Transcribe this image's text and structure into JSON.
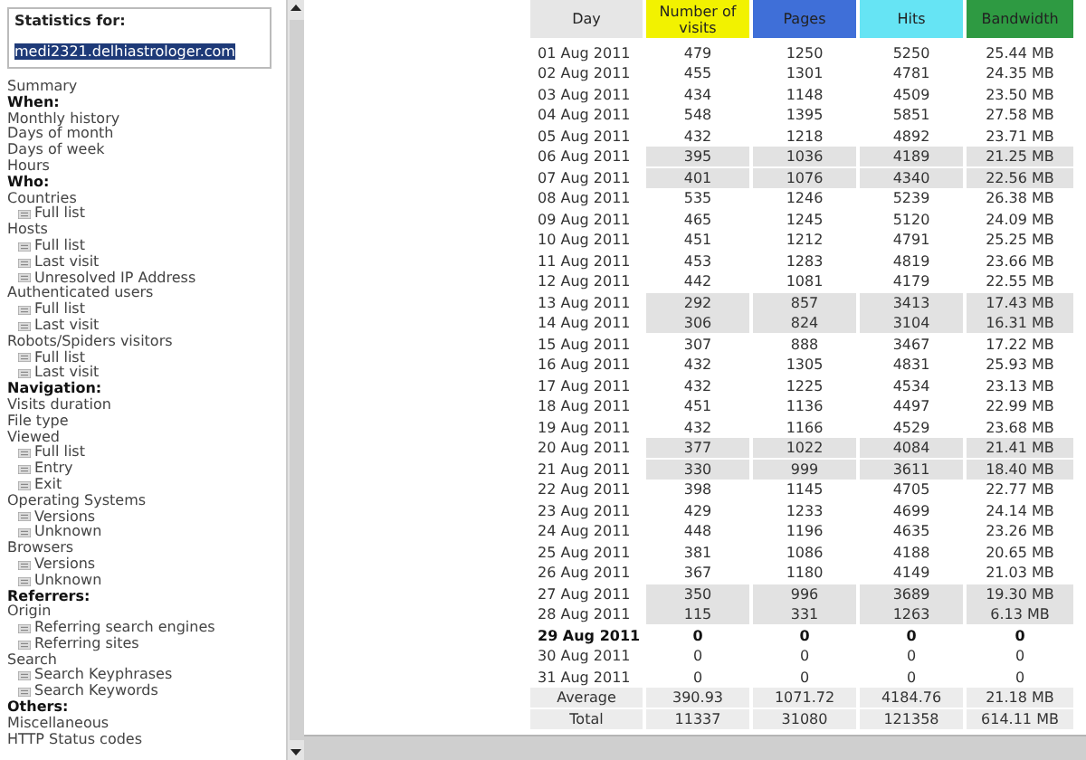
{
  "stats_box": {
    "label": "Statistics for:",
    "host": "medi2321.delhiastrologer.com"
  },
  "menu": [
    {
      "kind": "link",
      "label": "Summary"
    },
    {
      "kind": "heading",
      "label": "When:"
    },
    {
      "kind": "link",
      "label": "Monthly history"
    },
    {
      "kind": "link",
      "label": "Days of month"
    },
    {
      "kind": "link",
      "label": "Days of week"
    },
    {
      "kind": "link",
      "label": "Hours"
    },
    {
      "kind": "heading",
      "label": "Who:"
    },
    {
      "kind": "link",
      "label": "Countries",
      "children": [
        {
          "label": "Full list"
        }
      ]
    },
    {
      "kind": "link",
      "label": "Hosts",
      "children": [
        {
          "label": "Full list"
        },
        {
          "label": "Last visit"
        },
        {
          "label": "Unresolved IP Address"
        }
      ]
    },
    {
      "kind": "link",
      "label": "Authenticated users",
      "children": [
        {
          "label": "Full list"
        },
        {
          "label": "Last visit"
        }
      ]
    },
    {
      "kind": "link",
      "label": "Robots/Spiders visitors",
      "children": [
        {
          "label": "Full list"
        },
        {
          "label": "Last visit"
        }
      ]
    },
    {
      "kind": "heading",
      "label": "Navigation:"
    },
    {
      "kind": "link",
      "label": "Visits duration"
    },
    {
      "kind": "link",
      "label": "File type"
    },
    {
      "kind": "link",
      "label": "Viewed",
      "children": [
        {
          "label": "Full list"
        },
        {
          "label": "Entry"
        },
        {
          "label": "Exit"
        }
      ]
    },
    {
      "kind": "link",
      "label": "Operating Systems",
      "children": [
        {
          "label": "Versions"
        },
        {
          "label": "Unknown"
        }
      ]
    },
    {
      "kind": "link",
      "label": "Browsers",
      "children": [
        {
          "label": "Versions"
        },
        {
          "label": "Unknown"
        }
      ]
    },
    {
      "kind": "heading",
      "label": "Referrers:"
    },
    {
      "kind": "link",
      "label": "Origin",
      "children": [
        {
          "label": "Referring search engines"
        },
        {
          "label": "Referring sites"
        }
      ]
    },
    {
      "kind": "link",
      "label": "Search",
      "children": [
        {
          "label": "Search Keyphrases"
        },
        {
          "label": "Search Keywords"
        }
      ]
    },
    {
      "kind": "heading",
      "label": "Others:"
    },
    {
      "kind": "link",
      "label": "Miscellaneous"
    },
    {
      "kind": "link",
      "label": "HTTP Status codes"
    }
  ],
  "table": {
    "columns": [
      {
        "label": "Day",
        "color": "#e6e6e6"
      },
      {
        "label": "Number of visits",
        "color": "#f2f200"
      },
      {
        "label": "Pages",
        "color": "#3f6fd8"
      },
      {
        "label": "Hits",
        "color": "#66e4f4"
      },
      {
        "label": "Bandwidth",
        "color": "#2e9a42"
      }
    ],
    "rows": [
      {
        "day": "01 Aug 2011",
        "visits": "479",
        "pages": "1250",
        "hits": "5250",
        "bandwidth": "25.44 MB",
        "weekend": false,
        "current": false
      },
      {
        "day": "02 Aug 2011",
        "visits": "455",
        "pages": "1301",
        "hits": "4781",
        "bandwidth": "24.35 MB",
        "weekend": false,
        "current": false
      },
      {
        "day": "03 Aug 2011",
        "visits": "434",
        "pages": "1148",
        "hits": "4509",
        "bandwidth": "23.50 MB",
        "weekend": false,
        "current": false
      },
      {
        "day": "04 Aug 2011",
        "visits": "548",
        "pages": "1395",
        "hits": "5851",
        "bandwidth": "27.58 MB",
        "weekend": false,
        "current": false
      },
      {
        "day": "05 Aug 2011",
        "visits": "432",
        "pages": "1218",
        "hits": "4892",
        "bandwidth": "23.71 MB",
        "weekend": false,
        "current": false
      },
      {
        "day": "06 Aug 2011",
        "visits": "395",
        "pages": "1036",
        "hits": "4189",
        "bandwidth": "21.25 MB",
        "weekend": true,
        "current": false
      },
      {
        "day": "07 Aug 2011",
        "visits": "401",
        "pages": "1076",
        "hits": "4340",
        "bandwidth": "22.56 MB",
        "weekend": true,
        "current": false
      },
      {
        "day": "08 Aug 2011",
        "visits": "535",
        "pages": "1246",
        "hits": "5239",
        "bandwidth": "26.38 MB",
        "weekend": false,
        "current": false
      },
      {
        "day": "09 Aug 2011",
        "visits": "465",
        "pages": "1245",
        "hits": "5120",
        "bandwidth": "24.09 MB",
        "weekend": false,
        "current": false
      },
      {
        "day": "10 Aug 2011",
        "visits": "451",
        "pages": "1212",
        "hits": "4791",
        "bandwidth": "25.25 MB",
        "weekend": false,
        "current": false
      },
      {
        "day": "11 Aug 2011",
        "visits": "453",
        "pages": "1283",
        "hits": "4819",
        "bandwidth": "23.66 MB",
        "weekend": false,
        "current": false
      },
      {
        "day": "12 Aug 2011",
        "visits": "442",
        "pages": "1081",
        "hits": "4179",
        "bandwidth": "22.55 MB",
        "weekend": false,
        "current": false
      },
      {
        "day": "13 Aug 2011",
        "visits": "292",
        "pages": "857",
        "hits": "3413",
        "bandwidth": "17.43 MB",
        "weekend": true,
        "current": false
      },
      {
        "day": "14 Aug 2011",
        "visits": "306",
        "pages": "824",
        "hits": "3104",
        "bandwidth": "16.31 MB",
        "weekend": true,
        "current": false
      },
      {
        "day": "15 Aug 2011",
        "visits": "307",
        "pages": "888",
        "hits": "3467",
        "bandwidth": "17.22 MB",
        "weekend": false,
        "current": false
      },
      {
        "day": "16 Aug 2011",
        "visits": "432",
        "pages": "1305",
        "hits": "4831",
        "bandwidth": "25.93 MB",
        "weekend": false,
        "current": false
      },
      {
        "day": "17 Aug 2011",
        "visits": "432",
        "pages": "1225",
        "hits": "4534",
        "bandwidth": "23.13 MB",
        "weekend": false,
        "current": false
      },
      {
        "day": "18 Aug 2011",
        "visits": "451",
        "pages": "1136",
        "hits": "4497",
        "bandwidth": "22.99 MB",
        "weekend": false,
        "current": false
      },
      {
        "day": "19 Aug 2011",
        "visits": "432",
        "pages": "1166",
        "hits": "4529",
        "bandwidth": "23.68 MB",
        "weekend": false,
        "current": false
      },
      {
        "day": "20 Aug 2011",
        "visits": "377",
        "pages": "1022",
        "hits": "4084",
        "bandwidth": "21.41 MB",
        "weekend": true,
        "current": false
      },
      {
        "day": "21 Aug 2011",
        "visits": "330",
        "pages": "999",
        "hits": "3611",
        "bandwidth": "18.40 MB",
        "weekend": true,
        "current": false
      },
      {
        "day": "22 Aug 2011",
        "visits": "398",
        "pages": "1145",
        "hits": "4705",
        "bandwidth": "22.77 MB",
        "weekend": false,
        "current": false
      },
      {
        "day": "23 Aug 2011",
        "visits": "429",
        "pages": "1233",
        "hits": "4699",
        "bandwidth": "24.14 MB",
        "weekend": false,
        "current": false
      },
      {
        "day": "24 Aug 2011",
        "visits": "448",
        "pages": "1196",
        "hits": "4635",
        "bandwidth": "23.26 MB",
        "weekend": false,
        "current": false
      },
      {
        "day": "25 Aug 2011",
        "visits": "381",
        "pages": "1086",
        "hits": "4188",
        "bandwidth": "20.65 MB",
        "weekend": false,
        "current": false
      },
      {
        "day": "26 Aug 2011",
        "visits": "367",
        "pages": "1180",
        "hits": "4149",
        "bandwidth": "21.03 MB",
        "weekend": false,
        "current": false
      },
      {
        "day": "27 Aug 2011",
        "visits": "350",
        "pages": "996",
        "hits": "3689",
        "bandwidth": "19.30 MB",
        "weekend": true,
        "current": false
      },
      {
        "day": "28 Aug 2011",
        "visits": "115",
        "pages": "331",
        "hits": "1263",
        "bandwidth": "6.13 MB",
        "weekend": true,
        "current": false
      },
      {
        "day": "29 Aug 2011",
        "visits": "0",
        "pages": "0",
        "hits": "0",
        "bandwidth": "0",
        "weekend": false,
        "current": true
      },
      {
        "day": "30 Aug 2011",
        "visits": "0",
        "pages": "0",
        "hits": "0",
        "bandwidth": "0",
        "weekend": false,
        "current": false
      },
      {
        "day": "31 Aug 2011",
        "visits": "0",
        "pages": "0",
        "hits": "0",
        "bandwidth": "0",
        "weekend": false,
        "current": false
      }
    ],
    "summary": [
      {
        "label": "Average",
        "visits": "390.93",
        "pages": "1071.72",
        "hits": "4184.76",
        "bandwidth": "21.18 MB"
      },
      {
        "label": "Total",
        "visits": "11337",
        "pages": "31080",
        "hits": "121358",
        "bandwidth": "614.11 MB"
      }
    ]
  }
}
